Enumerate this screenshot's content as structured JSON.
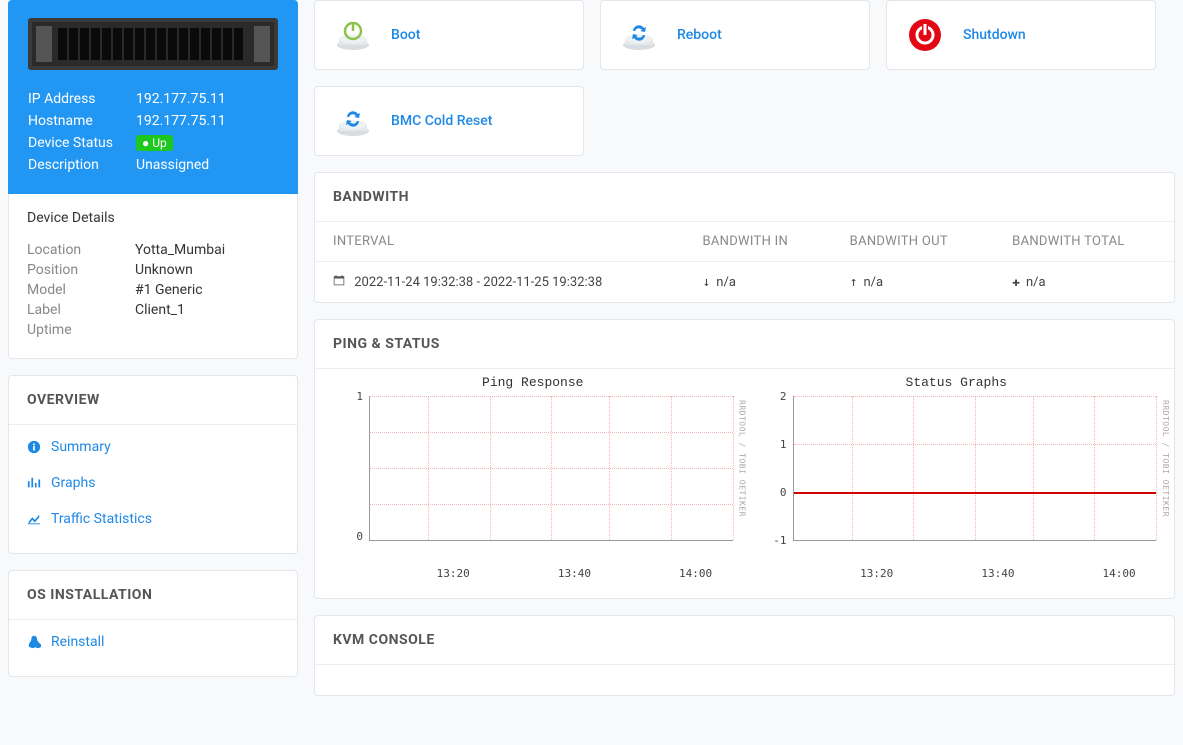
{
  "device": {
    "ip_label": "IP Address",
    "ip": "192.177.75.11",
    "hostname_label": "Hostname",
    "hostname": "192.177.75.11",
    "status_label": "Device Status",
    "status_badge": "Up",
    "description_label": "Description",
    "description": "Unassigned"
  },
  "details": {
    "heading": "Device Details",
    "location_label": "Location",
    "location": "Yotta_Mumbai",
    "position_label": "Position",
    "position": "Unknown",
    "model_label": "Model",
    "model": "#1 Generic",
    "label_label": "Label",
    "label": "Client_1",
    "uptime_label": "Uptime",
    "uptime": ""
  },
  "overview": {
    "heading": "OVERVIEW",
    "items": {
      "summary": "Summary",
      "graphs": "Graphs",
      "traffic": "Traffic Statistics"
    }
  },
  "osinstall": {
    "heading": "OS INSTALLATION",
    "reinstall": "Reinstall"
  },
  "actions": {
    "boot": "Boot",
    "reboot": "Reboot",
    "shutdown": "Shutdown",
    "bmc_reset": "BMC Cold Reset"
  },
  "bandwidth": {
    "heading": "BANDWITH",
    "col_interval": "INTERVAL",
    "col_in": "BANDWITH IN",
    "col_out": "BANDWITH OUT",
    "col_total": "BANDWITH TOTAL",
    "interval": "2022-11-24 19:32:38 - 2022-11-25 19:32:38",
    "in": "n/a",
    "out": "n/a",
    "total": "n/a"
  },
  "pingstatus": {
    "heading": "PING & STATUS",
    "ping_title": "Ping Response",
    "status_title": "Status Graphs",
    "rrdtool": "RRDTOOL / TOBI OETIKER"
  },
  "kvm": {
    "heading": "KVM CONSOLE"
  },
  "chart_data": [
    {
      "type": "line",
      "title": "Ping Response",
      "xticks": [
        "13:20",
        "13:40",
        "14:00"
      ],
      "yticks": [
        0,
        1
      ],
      "ylim": [
        0,
        1
      ],
      "series": [
        {
          "name": "ping",
          "values": []
        }
      ]
    },
    {
      "type": "line",
      "title": "Status Graphs",
      "xticks": [
        "13:20",
        "13:40",
        "14:00"
      ],
      "yticks": [
        -1,
        0,
        1,
        2
      ],
      "ylim": [
        -1,
        2
      ],
      "series": [
        {
          "name": "status",
          "values": [
            0,
            0,
            0,
            0,
            0,
            0
          ]
        }
      ]
    }
  ]
}
